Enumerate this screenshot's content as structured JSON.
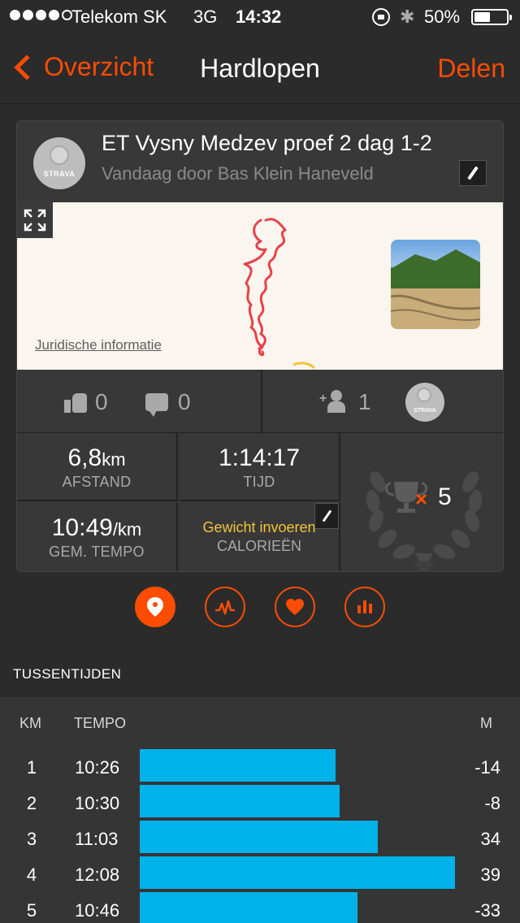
{
  "status_bar": {
    "carrier": "Telekom SK",
    "network": "3G",
    "time": "14:32",
    "battery": "50%",
    "battery_level": 0.5,
    "signal_bars": 4
  },
  "nav": {
    "back_label": "Overzicht",
    "title": "Hardlopen",
    "share_label": "Delen"
  },
  "activity": {
    "title": "ET Vysny Medzev proef 2 dag 1-2",
    "subtitle": "Vandaag door Bas Klein Haneveld",
    "avatar_brand": "STRAVA",
    "map_legal": "Juridische informatie",
    "kudos": "0",
    "comments": "0",
    "athletes": "1",
    "small_avatar_brand": "STRAVA"
  },
  "stats": {
    "distance_value": "6,8",
    "distance_unit": "km",
    "distance_label": "AFSTAND",
    "time_value": "1:14:17",
    "time_label": "TIJD",
    "pace_value": "10:49",
    "pace_unit": "/km",
    "pace_label": "GEM. TEMPO",
    "weight_prompt": "Gewicht invoeren",
    "calories_label": "CALORIEËN",
    "achievements_multiplier": "×",
    "achievements_count": "5"
  },
  "tabs": [
    {
      "icon": "map-pin-icon",
      "active": true
    },
    {
      "icon": "activity-graph-icon",
      "active": false
    },
    {
      "icon": "heart-icon",
      "active": false
    },
    {
      "icon": "bar-chart-icon",
      "active": false
    }
  ],
  "splits": {
    "section_title": "TUSSENTIJDEN",
    "col_km": "KM",
    "col_tempo": "TEMPO",
    "col_m": "M",
    "rows": [
      {
        "km": "1",
        "tempo": "10:26",
        "m": "-14",
        "pace_fraction": 0.62
      },
      {
        "km": "2",
        "tempo": "10:30",
        "m": "-8",
        "pace_fraction": 0.635
      },
      {
        "km": "3",
        "tempo": "11:03",
        "m": "34",
        "pace_fraction": 0.755
      },
      {
        "km": "4",
        "tempo": "12:08",
        "m": "39",
        "pace_fraction": 1.0
      },
      {
        "km": "5",
        "tempo": "10:46",
        "m": "-33",
        "pace_fraction": 0.69
      }
    ]
  },
  "colors": {
    "accent": "#fc4c02",
    "bar": "#00b2ea",
    "warning": "#f4c33a",
    "route": "#e8414a"
  }
}
